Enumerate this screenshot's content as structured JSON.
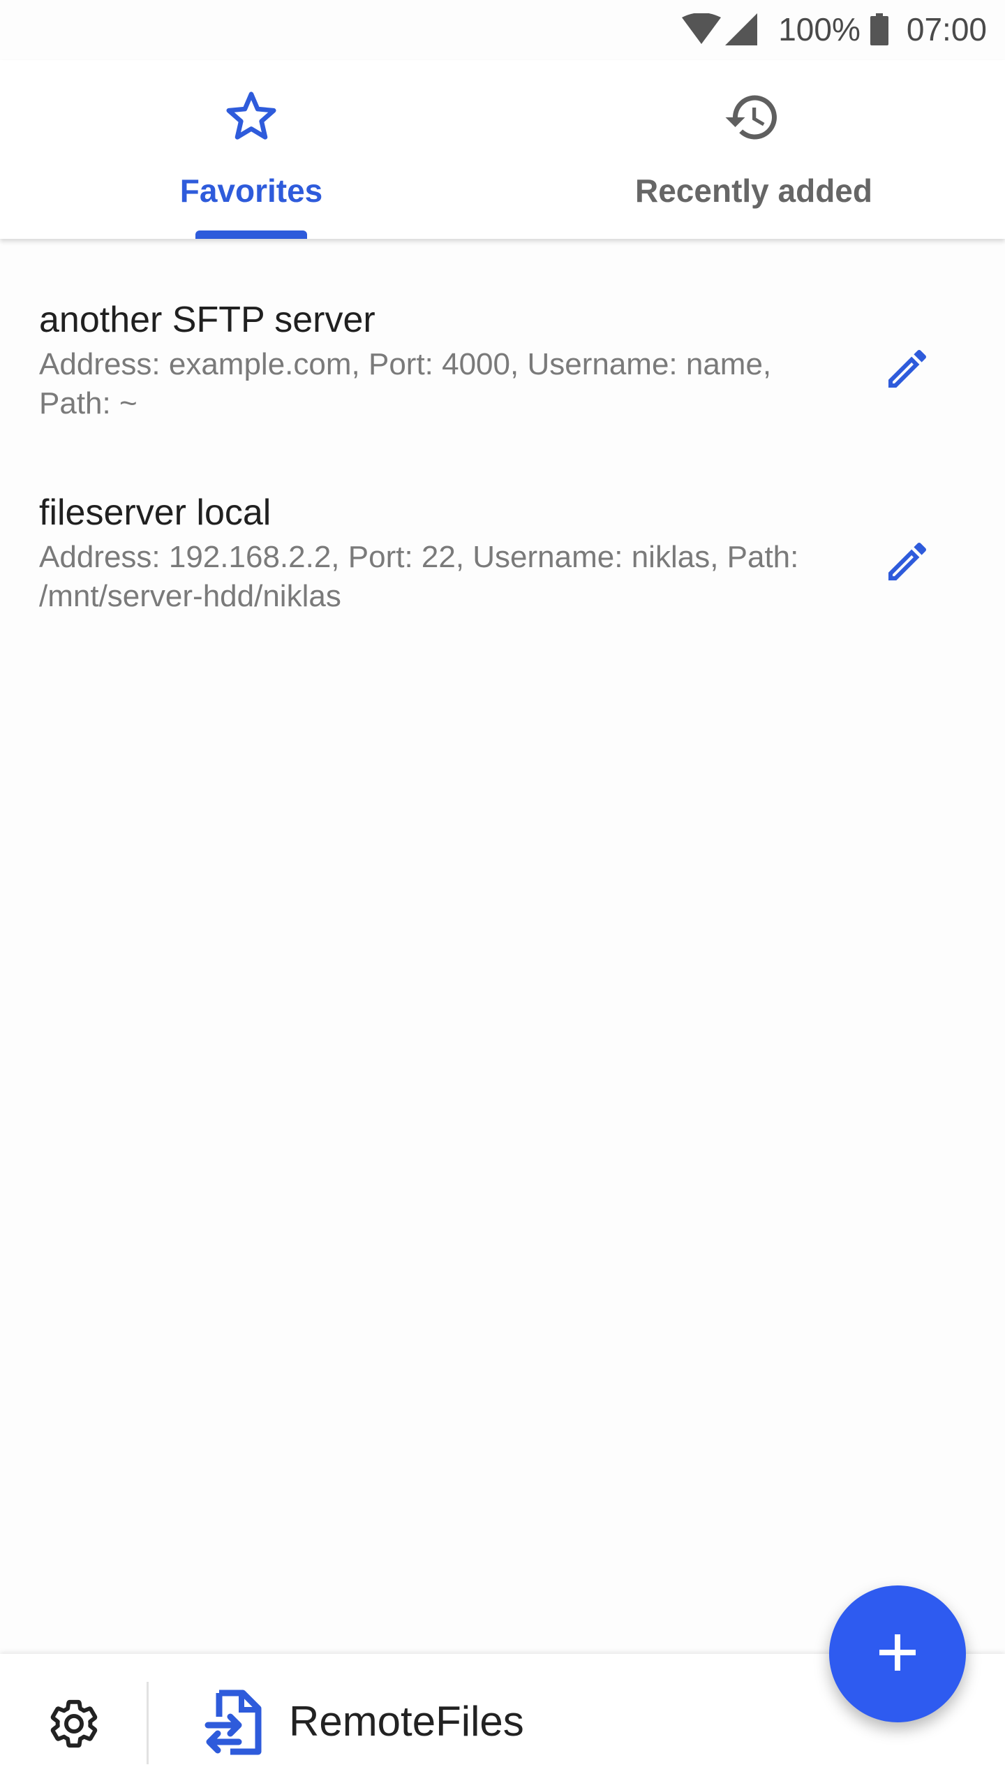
{
  "status_bar": {
    "battery_percent": "100%",
    "time": "07:00",
    "icons": [
      "wifi-icon",
      "signal-icon",
      "battery-icon"
    ]
  },
  "tabs": [
    {
      "label": "Favorites",
      "icon": "star-outline-icon",
      "selected": true
    },
    {
      "label": "Recently added",
      "icon": "history-icon",
      "selected": false
    }
  ],
  "servers": [
    {
      "name": "another SFTP server",
      "details": "Address: example.com, Port: 4000, Username: name, Path: ~",
      "edit_icon": "pencil-icon"
    },
    {
      "name": "fileserver local",
      "details": "Address: 192.168.2.2, Port: 22, Username: niklas, Path: /mnt/server-hdd/niklas",
      "edit_icon": "pencil-icon"
    }
  ],
  "fab": {
    "icon": "plus-icon"
  },
  "bottom_bar": {
    "settings_icon": "gear-icon",
    "app_icon": "file-transfer-icon",
    "app_name": "RemoteFiles"
  },
  "colors": {
    "accent": "#2e5bdb",
    "fab": "#2e5bf0",
    "text_primary": "#202020",
    "text_secondary": "#7a7a7a",
    "tab_inactive": "#666666"
  }
}
